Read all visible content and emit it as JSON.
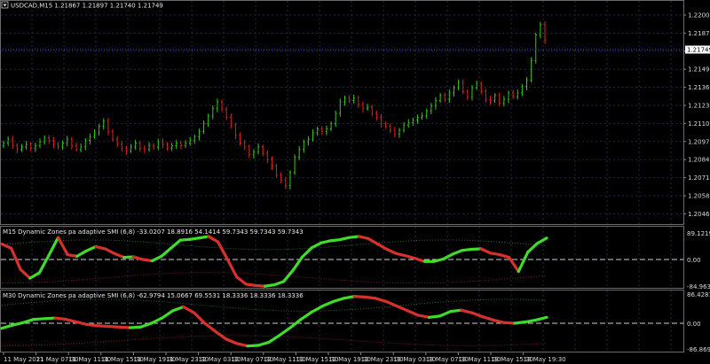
{
  "colors": {
    "background": "#000000",
    "grid": "#1f2a44",
    "frame": "#6a6a6a",
    "bull": "#39c91a",
    "bear": "#e0231f",
    "smi_up": "#3fdc2a",
    "smi_down": "#d8302a",
    "zone": "#2a6e2a",
    "zone_dn": "#7a2222",
    "zero_line": "#cfcfcf",
    "price_line": "#3d4cff",
    "label_fg": "#000000",
    "label_bg": "#ffffff"
  },
  "main": {
    "symbol_info": "USDCAD,M15  1.21867 1.21897 1.21740 1.21749",
    "price_axis": [
      "1.22005",
      "1.21875",
      "1.21619",
      "1.21495",
      "1.21365",
      "1.21235",
      "1.21105",
      "1.20975",
      "1.20845",
      "1.20715",
      "1.20585",
      "1.20460"
    ],
    "current_price": "1.21749"
  },
  "indicator1": {
    "title": "M15 Dynamic Zones pa adaptive SMI (6,8) -33.0207 18.8916 54.1414 59.7343 59.7343 59.7343",
    "axis_top": "89.1219",
    "axis_zero": "0.00",
    "axis_bottom": "-84.9632"
  },
  "indicator2": {
    "title": "M30 Dynamic Zones pa adaptive SMI (6,8) -62.9794 15.0667 69.5531 18.3336 18.3336 18.3336",
    "axis_top": "86.4281",
    "axis_zero": "0.00",
    "axis_bottom": "-86.8691"
  },
  "time_axis": [
    "11 May 2021",
    "11 May 07:30",
    "11 May 11:30",
    "11 May 15:30",
    "11 May 19:30",
    "11 May 23:30",
    "12 May 03:30",
    "12 May 07:30",
    "12 May 11:30",
    "12 May 15:30",
    "12 May 19:30",
    "12 May 23:30",
    "13 May 03:30",
    "13 May 07:30",
    "13 May 11:30",
    "13 May 15:30",
    "13 May 19:30"
  ],
  "chart_data": {
    "type": "line",
    "price_series": [
      1.2101,
      1.2104,
      1.2099,
      1.2096,
      1.2098,
      1.21,
      1.2097,
      1.2099,
      1.2102,
      1.2105,
      1.2103,
      1.21,
      1.2098,
      1.2101,
      1.2104,
      1.2099,
      1.2096,
      1.2098,
      1.2103,
      1.2106,
      1.2109,
      1.2114,
      1.2118,
      1.211,
      1.2104,
      1.21,
      1.2097,
      1.2095,
      1.2098,
      1.2101,
      1.2097,
      1.2096,
      1.2099,
      1.2098,
      1.2102,
      1.21,
      1.2097,
      1.2099,
      1.2101,
      1.2099,
      1.2101,
      1.2103,
      1.2106,
      1.211,
      1.2116,
      1.2122,
      1.2128,
      1.2133,
      1.2127,
      1.2121,
      1.2115,
      1.2107,
      1.2101,
      1.2098,
      1.2092,
      1.2094,
      1.2098,
      1.2093,
      1.2088,
      1.2083,
      1.2076,
      1.2072,
      1.2068,
      1.2078,
      1.209,
      1.2096,
      1.2102,
      1.2104,
      1.2109,
      1.2112,
      1.211,
      1.2112,
      1.2116,
      1.2124,
      1.2133,
      1.2136,
      1.2134,
      1.2136,
      1.2131,
      1.2128,
      1.2129,
      1.2124,
      1.2121,
      1.2116,
      1.2114,
      1.2111,
      1.2108,
      1.2111,
      1.2115,
      1.2117,
      1.2119,
      1.2121,
      1.2122,
      1.2126,
      1.213,
      1.2134,
      1.2138,
      1.2135,
      1.214,
      1.2144,
      1.2148,
      1.2141,
      1.2137,
      1.2144,
      1.2147,
      1.2141,
      1.2135,
      1.2134,
      1.2138,
      1.2132,
      1.2135,
      1.214,
      1.2137,
      1.214,
      1.2145,
      1.215,
      1.2165,
      1.2185,
      1.2193,
      1.2181
    ],
    "smi_m15": [
      58,
      42,
      -30,
      -56,
      -40,
      15,
      82,
      18,
      12,
      32,
      48,
      40,
      22,
      8,
      10,
      0,
      -4,
      12,
      42,
      72,
      75,
      80,
      86,
      66,
      2,
      -52,
      -74,
      -78,
      -80,
      -76,
      -66,
      -32,
      10,
      44,
      62,
      70,
      74,
      82,
      86,
      78,
      58,
      38,
      22,
      14,
      4,
      -6,
      -6,
      2,
      20,
      34,
      38,
      40,
      24,
      18,
      8,
      -36,
      28,
      60,
      80
    ],
    "smi_m30": [
      -16,
      -6,
      2,
      12,
      14,
      16,
      12,
      4,
      -4,
      -8,
      -10,
      -12,
      -14,
      -12,
      0,
      16,
      38,
      50,
      32,
      0,
      -26,
      -50,
      -64,
      -72,
      -70,
      -60,
      -38,
      -14,
      12,
      34,
      52,
      66,
      76,
      82,
      80,
      76,
      66,
      52,
      38,
      24,
      18,
      22,
      36,
      40,
      32,
      20,
      10,
      2,
      0,
      4,
      10,
      18
    ]
  }
}
